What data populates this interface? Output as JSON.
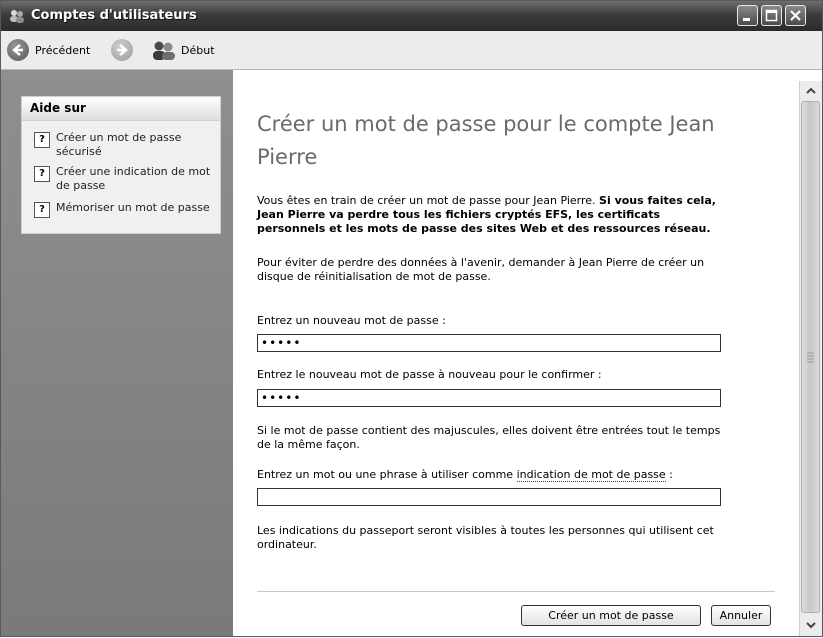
{
  "window": {
    "title": "Comptes d'utilisateurs"
  },
  "toolbar": {
    "back_label": "Précédent",
    "home_label": "Début"
  },
  "sidebar": {
    "heading": "Aide sur",
    "items": [
      {
        "label": "Créer un mot de passe sécurisé",
        "icon": "help-icon"
      },
      {
        "label": "Créer une indication de mot de passe",
        "icon": "help-icon"
      },
      {
        "label": "Mémoriser un mot de passe",
        "icon": "help-icon"
      }
    ]
  },
  "main": {
    "title": "Créer un mot de passe pour le compte Jean Pierre",
    "intro_plain": "Vous êtes en train de créer un mot de passe pour Jean Pierre. ",
    "intro_bold": "Si vous faites cela, Jean Pierre va perdre tous les fichiers cryptés EFS, les certificats personnels et les mots de passe des sites Web et des ressources réseau.",
    "reset_disk_text": "Pour éviter de perdre des données à l'avenir, demander à Jean Pierre de créer un disque de réinitialisation de mot de passe.",
    "new_password_label": "Entrez un nouveau mot de passe :",
    "new_password_value": "•••••",
    "confirm_password_label": "Entrez le nouveau mot de passe à nouveau pour le confirmer :",
    "confirm_password_value": "•••••",
    "case_note": "Si le mot de passe contient des majuscules, elles doivent être entrées tout le temps de la même façon.",
    "hint_label_prefix": "Entrez un mot ou une phrase à utiliser comme ",
    "hint_label_link": "indication de mot de passe",
    "hint_label_suffix": " :",
    "hint_value": "",
    "passport_note": "Les indications du passeport seront visibles à toutes les personnes qui utilisent cet ordinateur.",
    "create_button": "Créer un mot de passe",
    "cancel_button": "Annuler"
  }
}
